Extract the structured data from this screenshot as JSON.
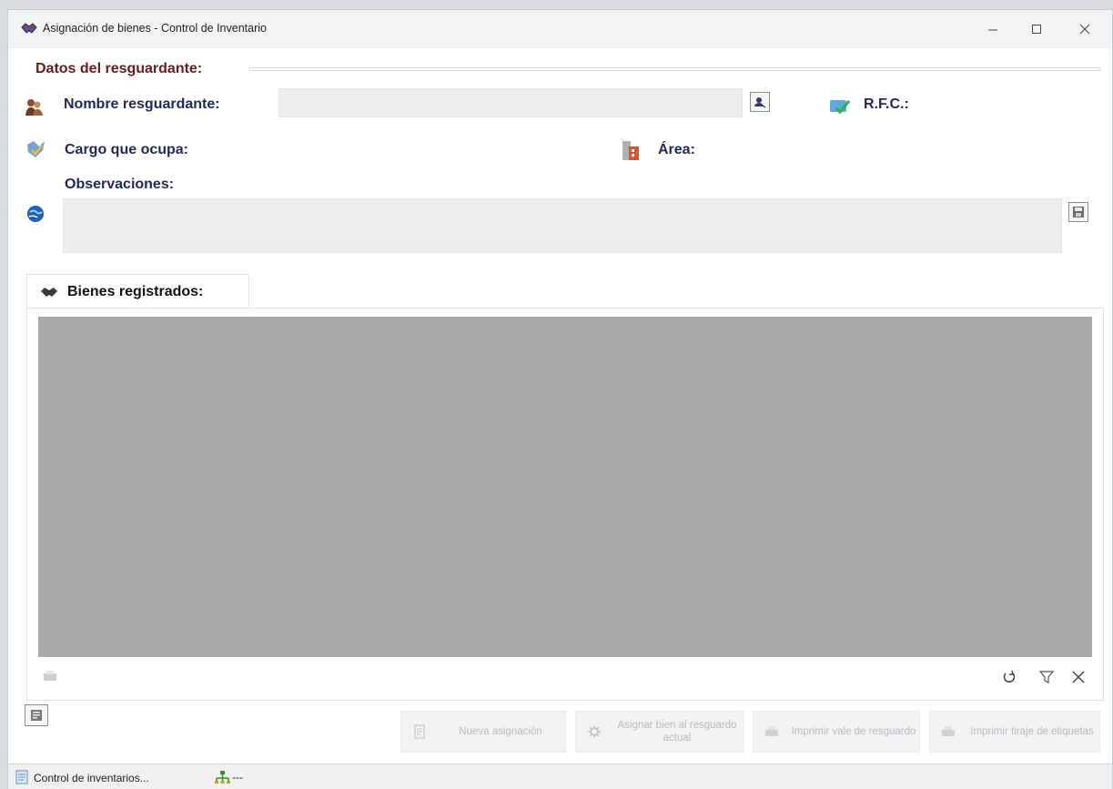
{
  "window": {
    "title": "Asignación de bienes  - Control de Inventario"
  },
  "resguardante": {
    "section_title": "Datos del resguardante:",
    "nombre_label": "Nombre resguardante:",
    "nombre_value": "",
    "rfc_label": "R.F.C.:",
    "cargo_label": "Cargo que ocupa:",
    "area_label": "Área:",
    "observaciones_label": "Observaciones:",
    "observaciones_value": ""
  },
  "bienes": {
    "tab_label": "Bienes registrados:"
  },
  "actions": {
    "nueva": "Nueva asignación",
    "asignar": "Asignar bien al resguardo actual",
    "imprimir_vale": "Imprimir vale de resguardo",
    "imprimir_etiquetas": "Imprimir tiraje de etiquetas"
  },
  "statusbar": {
    "left_text": "Control de inventarios...",
    "right_text": "---"
  },
  "colors": {
    "section_title": "#6b1b1b",
    "label": "#1f2a5a",
    "grid": "#a9a9a9"
  }
}
